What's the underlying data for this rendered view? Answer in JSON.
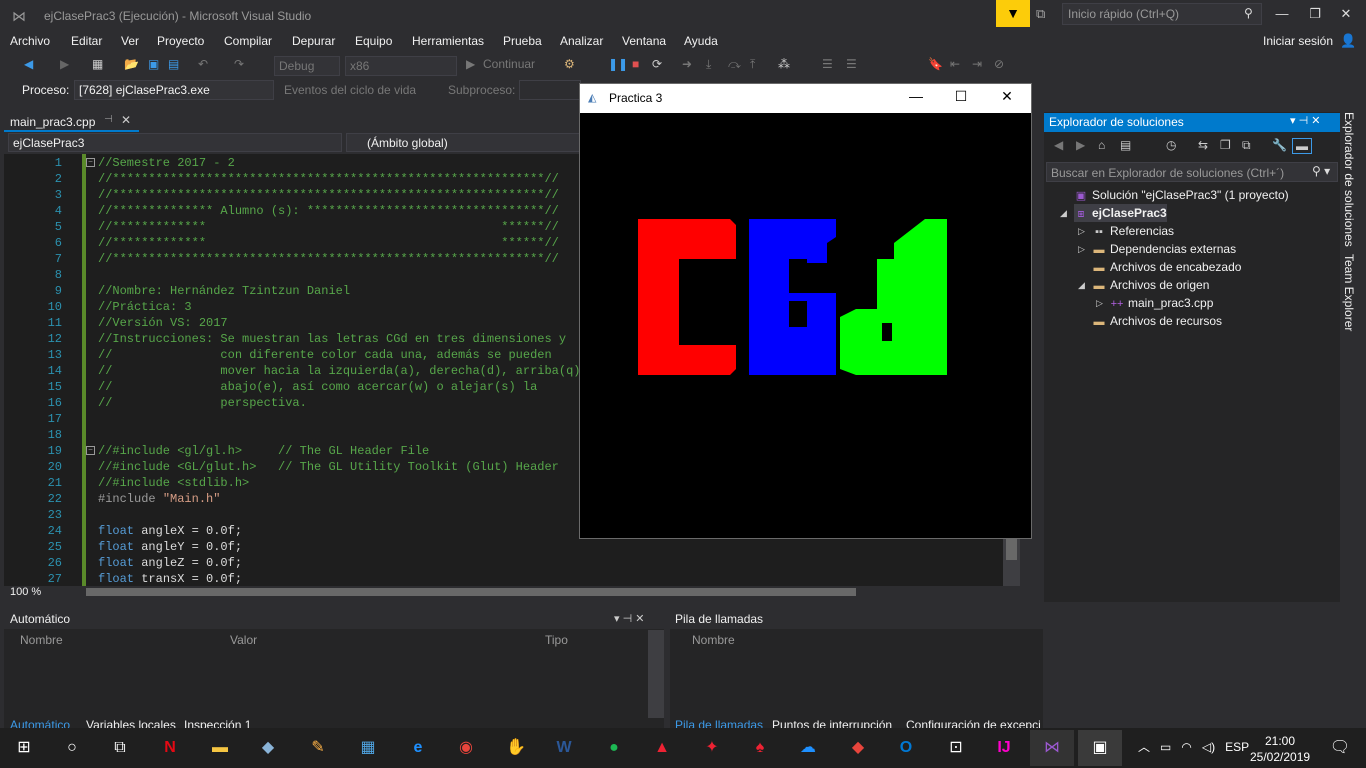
{
  "app": {
    "title": "ejClasePrac3 (Ejecución) - Microsoft Visual Studio",
    "quick_launch_placeholder": "Inicio rápido (Ctrl+Q)",
    "signin": "Iniciar sesión"
  },
  "menu": [
    "Archivo",
    "Editar",
    "Ver",
    "Proyecto",
    "Compilar",
    "Depurar",
    "Equipo",
    "Herramientas",
    "Prueba",
    "Analizar",
    "Ventana",
    "Ayuda"
  ],
  "toolbar": {
    "config": "Debug",
    "platform": "x86",
    "continue": "Continuar"
  },
  "process": {
    "label": "Proceso:",
    "value": "[7628] ejClasePrac3.exe",
    "events": "Eventos del ciclo de vida",
    "subprocess": "Subproceso:"
  },
  "editor": {
    "tab": "main_prac3.cpp",
    "nav_project": "ejClasePrac3",
    "nav_scope": "(Ámbito global)",
    "zoom": "100 %",
    "lines": [
      {
        "n": "1",
        "t": "//Semestre 2017 - 2",
        "c": "cmt"
      },
      {
        "n": "2",
        "t": "//************************************************************//",
        "c": "cmt"
      },
      {
        "n": "3",
        "t": "//************************************************************//",
        "c": "cmt"
      },
      {
        "n": "4",
        "t": "//************** Alumno (s): *********************************//",
        "c": "cmt"
      },
      {
        "n": "5",
        "t": "//*************                                         ******//",
        "c": "cmt"
      },
      {
        "n": "6",
        "t": "//*************                                         ******//",
        "c": "cmt"
      },
      {
        "n": "7",
        "t": "//************************************************************//",
        "c": "cmt"
      },
      {
        "n": "8",
        "t": "",
        "c": "cmt"
      },
      {
        "n": "9",
        "t": "//Nombre: Hernández Tzintzun Daniel",
        "c": "cmt"
      },
      {
        "n": "10",
        "t": "//Práctica: 3",
        "c": "cmt"
      },
      {
        "n": "11",
        "t": "//Versión VS: 2017",
        "c": "cmt"
      },
      {
        "n": "12",
        "t": "//Instrucciones: Se muestran las letras CGd en tres dimensiones y",
        "c": "cmt"
      },
      {
        "n": "13",
        "t": "//               con diferente color cada una, además se pueden",
        "c": "cmt"
      },
      {
        "n": "14",
        "t": "//               mover hacia la izquierda(a), derecha(d), arriba(q),",
        "c": "cmt"
      },
      {
        "n": "15",
        "t": "//               abajo(e), así como acercar(w) o alejar(s) la",
        "c": "cmt"
      },
      {
        "n": "16",
        "t": "//               perspectiva.",
        "c": "cmt"
      },
      {
        "n": "17",
        "t": "",
        "c": "cmt"
      },
      {
        "n": "18",
        "t": "",
        "c": "cmt"
      },
      {
        "n": "19",
        "t": "//#include <gl/gl.h>     // The GL Header File",
        "c": "cmt"
      },
      {
        "n": "20",
        "t": "//#include <GL/glut.h>   // The GL Utility Toolkit (Glut) Header",
        "c": "cmt"
      },
      {
        "n": "21",
        "t": "//#include <stdlib.h>",
        "c": "cmt"
      },
      {
        "n": "22",
        "t": "#include \"Main.h\"",
        "c": "inc"
      },
      {
        "n": "23",
        "t": "",
        "c": "cmt"
      },
      {
        "n": "24",
        "t": "float angleX = 0.0f;",
        "c": "decl"
      },
      {
        "n": "25",
        "t": "float angleY = 0.0f;",
        "c": "decl"
      },
      {
        "n": "26",
        "t": "float angleZ = 0.0f;",
        "c": "decl"
      },
      {
        "n": "27",
        "t": "float transX = 0.0f;",
        "c": "decl"
      }
    ]
  },
  "practice_window": {
    "title": "Practica 3",
    "letters": "CGd",
    "colors": {
      "c": "#ff0000",
      "g": "#0000ff",
      "d": "#00ff00"
    }
  },
  "solution_explorer": {
    "title": "Explorador de soluciones",
    "search_placeholder": "Buscar en Explorador de soluciones (Ctrl+´)",
    "tree": [
      {
        "label": "Solución \"ejClasePrac3\"  (1 proyecto)",
        "icon": "solution-icon",
        "level": 0,
        "arrow": ""
      },
      {
        "label": "ejClasePrac3",
        "icon": "project-icon",
        "level": 0,
        "arrow": "open",
        "selected": true
      },
      {
        "label": "Referencias",
        "icon": "references-icon",
        "level": 1,
        "arrow": "closed"
      },
      {
        "label": "Dependencias externas",
        "icon": "folder-icon",
        "level": 1,
        "arrow": "closed"
      },
      {
        "label": "Archivos de encabezado",
        "icon": "folder-icon",
        "level": 1,
        "arrow": ""
      },
      {
        "label": "Archivos de origen",
        "icon": "folder-icon",
        "level": 1,
        "arrow": "open"
      },
      {
        "label": "main_prac3.cpp",
        "icon": "cpp-file-icon",
        "level": 2,
        "arrow": "closed"
      },
      {
        "label": "Archivos de recursos",
        "icon": "folder-icon",
        "level": 1,
        "arrow": ""
      }
    ],
    "side_tabs": [
      "Explorador de soluciones",
      "Team Explorer"
    ]
  },
  "autos": {
    "title": "Automático",
    "columns": [
      "Nombre",
      "Valor",
      "Tipo"
    ],
    "tabs": [
      "Automático",
      "Variables locales",
      "Inspección 1"
    ]
  },
  "callstack": {
    "title": "Pila de llamadas",
    "columns": [
      "Nombre"
    ],
    "tabs": [
      "Pila de llamadas",
      "Puntos de interrupción",
      "Configuración de excepci"
    ]
  },
  "taskbar": {
    "lang": "ESP",
    "time": "21:00",
    "date": "25/02/2019"
  }
}
